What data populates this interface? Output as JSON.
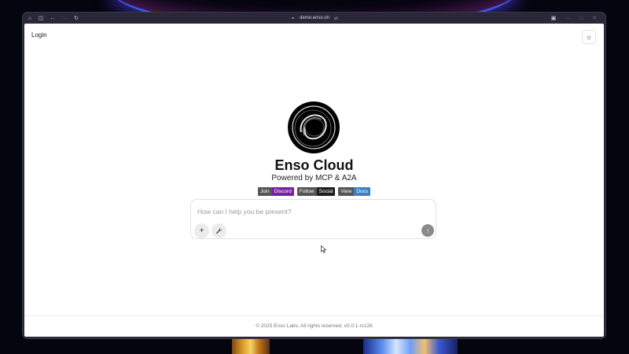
{
  "browser": {
    "url": "demo.enso.sh",
    "icons": {
      "home": "home-icon",
      "sidebar": "sidebar-icon",
      "back": "back-arrow-icon",
      "forward": "forward-arrow-icon",
      "reload": "reload-icon",
      "link": "link-icon",
      "sync": "sync-icon",
      "extensions": "extensions-icon",
      "minimize": "minimize-icon",
      "maximize": "maximize-icon",
      "close": "close-icon"
    }
  },
  "header": {
    "login_label": "Login",
    "theme_icon": "sun-icon"
  },
  "hero": {
    "title": "Enso Cloud",
    "subtitle": "Powered by MCP & A2A"
  },
  "badges": [
    {
      "left": "Join",
      "right": "Discord",
      "color": "#7b1fa2"
    },
    {
      "left": "Follow",
      "right": "Social",
      "color": "#1e1e1e"
    },
    {
      "left": "View",
      "right": "Docs",
      "color": "#3b82c4"
    }
  ],
  "chat": {
    "placeholder": "How can I help you be present?",
    "value": "",
    "add_icon": "plus-icon",
    "tools_icon": "wrench-icon",
    "send_icon": "arrow-up-icon"
  },
  "footer": {
    "text": "© 2025 Enso Labs. All rights reserved. v0.0.1-rc128"
  }
}
